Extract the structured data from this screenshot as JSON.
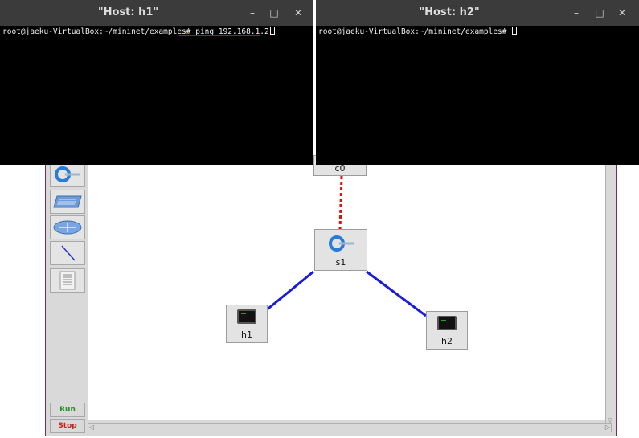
{
  "terminal_h1": {
    "title": "\"Host: h1\"",
    "prompt": "root@jaeku-VirtualBox:~/mininet/examples# ",
    "command": "ping 192.168.1.2",
    "minimize": "–",
    "maximize": "□",
    "close": "✕"
  },
  "terminal_h2": {
    "title": "\"Host: h2\"",
    "prompt": "root@jaeku-VirtualBox:~/mininet/examples# ",
    "command": "",
    "minimize": "–",
    "maximize": "□",
    "close": "✕"
  },
  "toolbar": {
    "tools": [
      "controller-tool",
      "switch-tool",
      "router-tool",
      "link-tool",
      "netlist-tool"
    ],
    "run_label": "Run",
    "stop_label": "Stop",
    "run_color": "#2e8b2e",
    "stop_color": "#cc2222"
  },
  "topology": {
    "controller": {
      "label": "c0"
    },
    "switch": {
      "label": "s1"
    },
    "hosts": [
      {
        "label": "h1"
      },
      {
        "label": "h2"
      }
    ],
    "link_color": "#1a1adc",
    "controller_link_color": "#e01010"
  },
  "colors": {
    "annotation_underline": "#d40000",
    "terminal_bg": "#000000",
    "titlebar_bg": "#3b3b3b"
  }
}
